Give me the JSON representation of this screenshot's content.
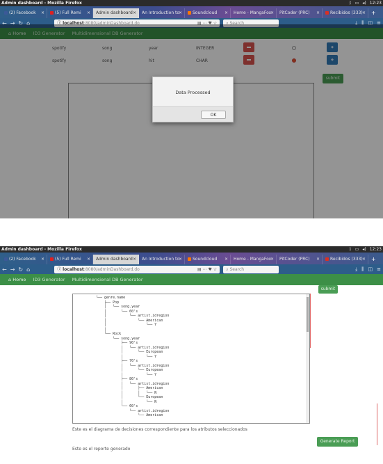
{
  "window": {
    "title": "Admin dashboard - Mozilla Firefox",
    "clock": "12:23"
  },
  "tabs": [
    {
      "label": "(2) Facebook",
      "color": "#3b5998"
    },
    {
      "label": "(5) Full Remi",
      "color": "#e02020"
    },
    {
      "label": "Admin dashboard",
      "color": "#888888"
    },
    {
      "label": "An Introduction to",
      "color": "#888888"
    },
    {
      "label": "Soundcloud",
      "color": "#ff7700"
    },
    {
      "label": "Home - MangaFox",
      "color": "#888888"
    },
    {
      "label": "PitCoder (PRC)",
      "color": "#888888"
    },
    {
      "label": "Recibidos (333)",
      "color": "#d93025"
    }
  ],
  "urlbar": {
    "host": "localhost",
    "path": ":8080/adminDashboard.do",
    "search_placeholder": "Search"
  },
  "appnav": {
    "home": "Home",
    "items": [
      "ID3 Generator",
      "Multidimensional DB Generator"
    ]
  },
  "rows": [
    {
      "col1": "spotify",
      "col2": "song",
      "col3": "year",
      "col4": "INTEGER",
      "selected": false
    },
    {
      "col1": "spotify",
      "col2": "song",
      "col3": "hit",
      "col4": "CHAR",
      "selected": true
    }
  ],
  "submit_label": "submit",
  "dialog": {
    "message": "Data Processed",
    "ok_label": "OK"
  },
  "tree_lines": [
    "└── genre.name",
    "    ├── Pop",
    "    │   └── song.year",
    "    │       └── 60's",
    "    │           └── artist.idregion",
    "    │               └── American",
    "    │                   └── Y",
    "    │",
    "    └── Rock",
    "        └── song.year",
    "            ├── 90's",
    "            │   └── artist.idregion",
    "            │       └── European",
    "            │           └── Y",
    "            ├── 70's",
    "            │   └── artist.idregion",
    "            │       └── European",
    "            │           └── Y",
    "            ├── 80's",
    "            │   └── artist.idregion",
    "            │       ├── American",
    "            │       │   └── N",
    "            │       └── European",
    "            │           └── N",
    "            └── 60's",
    "                └── artist.idregion",
    "                    └── American"
  ],
  "caption": "Este es el diagrama de decisiones correspondiente para los atributos seleccionados",
  "generate_report_label": "Generate Report",
  "report_text": "Este es el reporte generado"
}
